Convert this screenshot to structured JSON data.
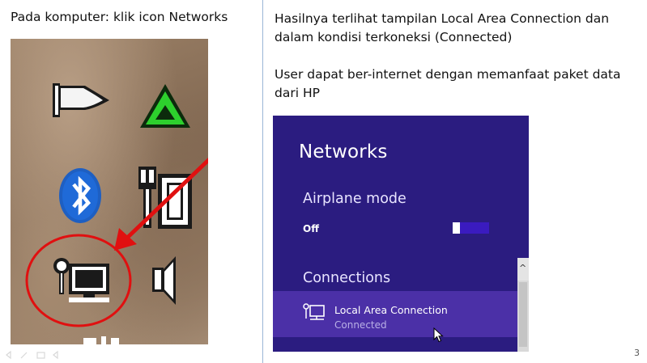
{
  "left": {
    "caption": "Pada komputer: klik icon Networks"
  },
  "right": {
    "line1": "Hasilnya terlihat tampilan Local Area Connection dan dalam kondisi terkoneksi (Connected)",
    "line2": "User dapat ber-internet dengan memanfaat paket data dari HP"
  },
  "tray_icons": [
    "flag-icon",
    "green-triangle-icon",
    "bluetooth-icon",
    "power-plug-battery-icon",
    "network-icon",
    "speaker-icon"
  ],
  "networks_panel": {
    "title": "Networks",
    "airplane_label": "Airplane mode",
    "airplane_state": "Off",
    "connections_label": "Connections",
    "connection": {
      "name": "Local Area Connection",
      "status": "Connected"
    }
  },
  "colors": {
    "panel_bg": "#2b1c80",
    "selected_row": "#4b30a7",
    "annotation_red": "#e01010"
  },
  "page_number": "3"
}
